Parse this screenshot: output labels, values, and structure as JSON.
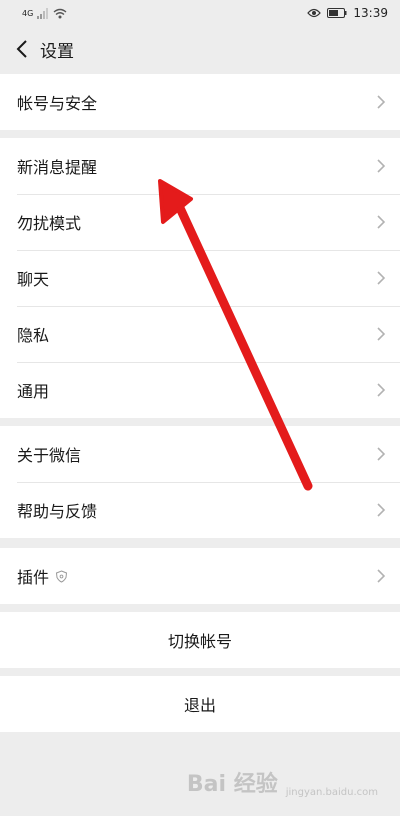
{
  "status_bar": {
    "network": "4G",
    "time": "13:39"
  },
  "header": {
    "title": "设置"
  },
  "groups": [
    {
      "items": [
        {
          "label": "帐号与安全"
        }
      ]
    },
    {
      "items": [
        {
          "label": "新消息提醒"
        },
        {
          "label": "勿扰模式"
        },
        {
          "label": "聊天"
        },
        {
          "label": "隐私"
        },
        {
          "label": "通用"
        }
      ]
    },
    {
      "items": [
        {
          "label": "关于微信"
        },
        {
          "label": "帮助与反馈"
        }
      ]
    },
    {
      "items": [
        {
          "label": "插件"
        }
      ]
    }
  ],
  "actions": {
    "switch_account": "切换帐号",
    "logout": "退出"
  },
  "watermark": {
    "text": "Bai 经验",
    "sub": "jingyan.baidu.com"
  },
  "colors": {
    "annotation_arrow": "#e41b1b",
    "background": "#ededed"
  }
}
